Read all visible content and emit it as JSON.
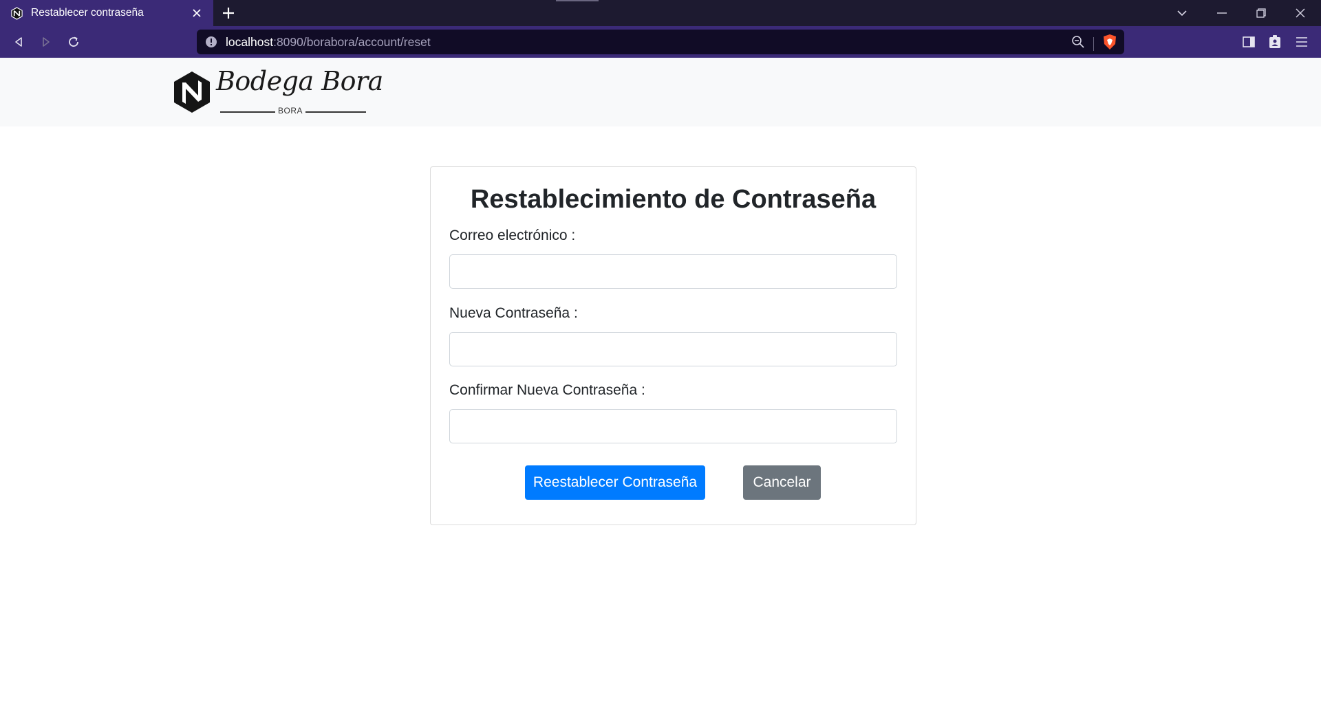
{
  "browser": {
    "tab_title": "Restablecer contraseña",
    "url_host": "localhost",
    "url_path": ":8090/borabora/account/reset"
  },
  "header": {
    "logo_text": "Bodega Bora",
    "logo_subtext": "BORA"
  },
  "form": {
    "title": "Restablecimiento de Contraseña",
    "email_label": "Correo electrónico :",
    "email_value": "",
    "new_password_label": "Nueva Contraseña :",
    "new_password_value": "",
    "confirm_password_label": "Confirmar Nueva Contraseña :",
    "confirm_password_value": "",
    "submit_label": "Reestablecer Contraseña",
    "cancel_label": "Cancelar"
  },
  "colors": {
    "primary": "#007bff",
    "secondary": "#6c757d",
    "browser_accent": "#3b2a77"
  }
}
